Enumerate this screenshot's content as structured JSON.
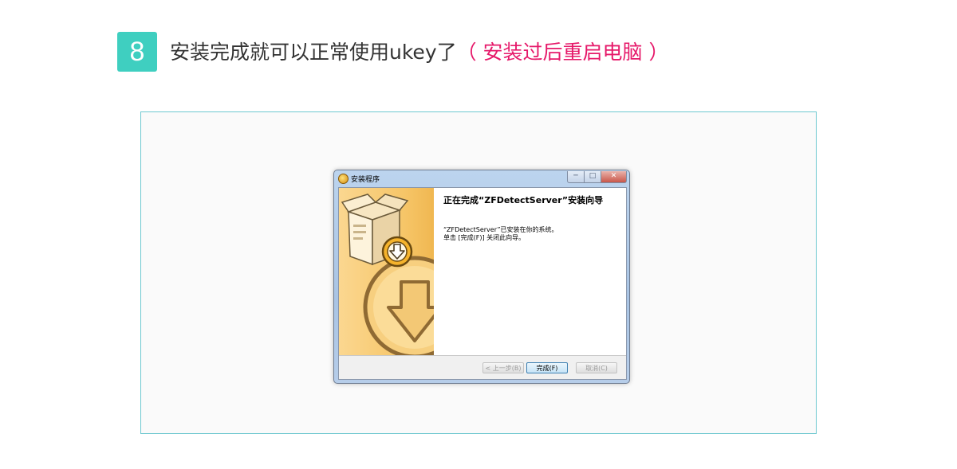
{
  "step": {
    "number": "8"
  },
  "heading": {
    "text": "安装完成就可以正常使用ukey了",
    "note": "（ 安装过后重启电脑 ）"
  },
  "installer": {
    "window_title": "安装程序",
    "controls": {
      "minimize": "─",
      "maximize": "□",
      "close": "✕"
    },
    "title": "正在完成“ZFDetectServer”安装向导",
    "line1": "“ZFDetectServer”已安装在你的系统。",
    "line2": "单击 [完成(F)] 关闭此向导。",
    "buttons": {
      "back": "< 上一步(B)",
      "finish": "完成(F)",
      "cancel": "取消(C)"
    }
  },
  "colors": {
    "badge": "#3fcfc0",
    "note": "#e6196a",
    "frame_border": "#6ec8d0"
  }
}
